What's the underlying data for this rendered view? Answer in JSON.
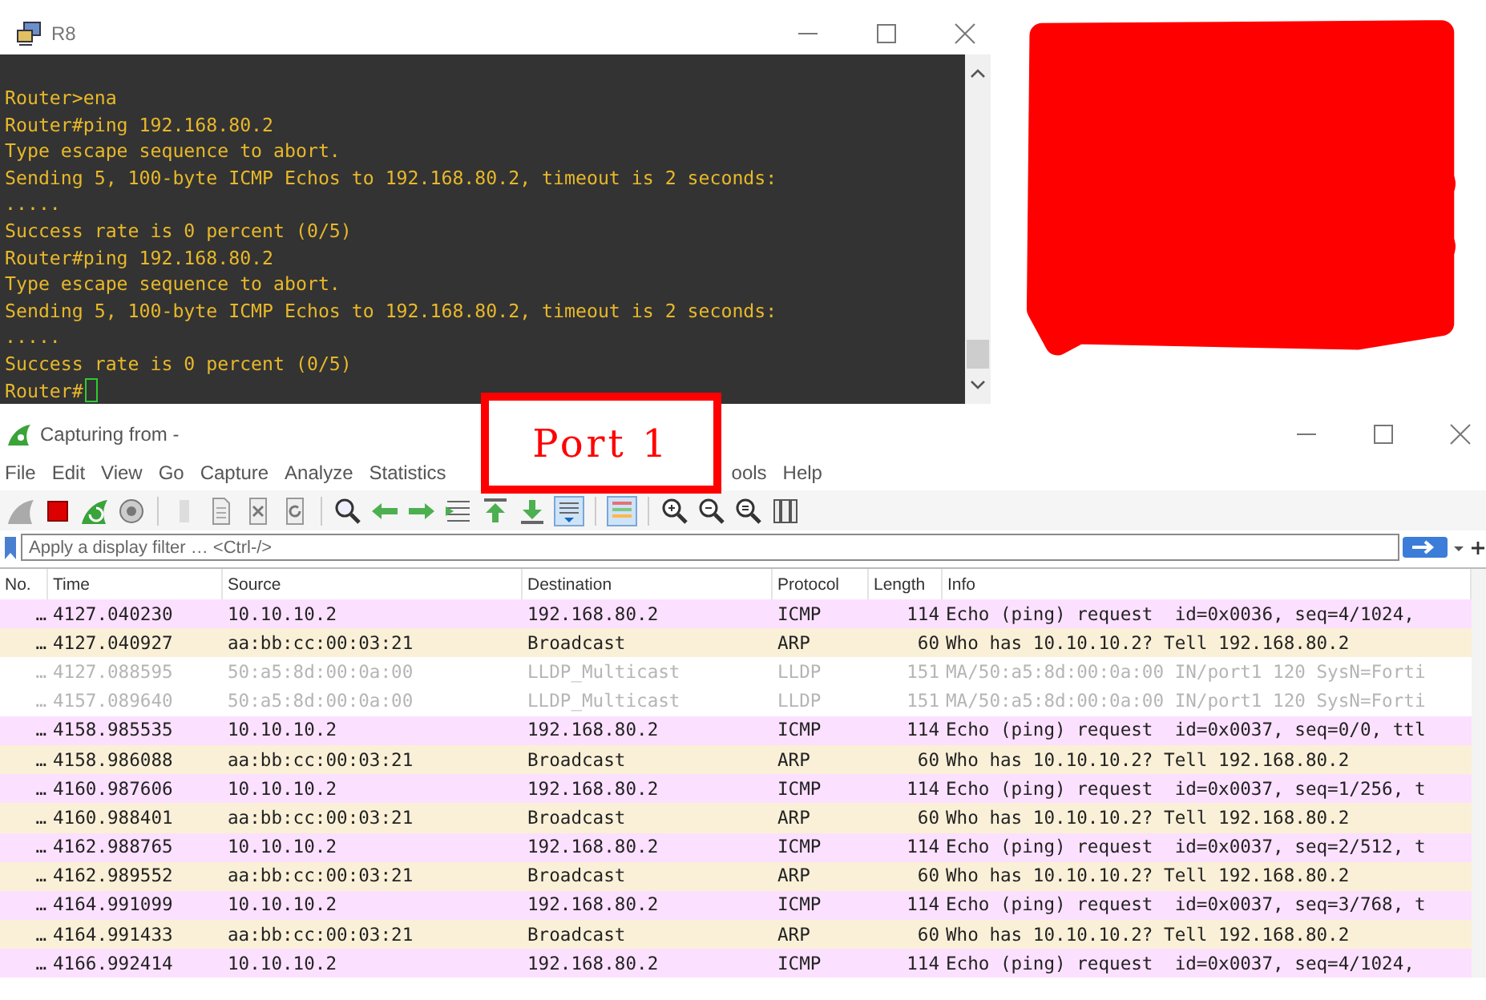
{
  "terminal": {
    "title": "R8",
    "cursor": true,
    "lines": [
      "Router>ena",
      "Router#ping 192.168.80.2",
      "Type escape sequence to abort.",
      "Sending 5, 100-byte ICMP Echos to 192.168.80.2, timeout is 2 seconds:",
      ".....",
      "Success rate is 0 percent (0/5)",
      "Router#ping 192.168.80.2",
      "Type escape sequence to abort.",
      "Sending 5, 100-byte ICMP Echos to 192.168.80.2, timeout is 2 seconds:",
      ".....",
      "Success rate is 0 percent (0/5)",
      "Router#"
    ]
  },
  "annotation": {
    "label": "Port 1"
  },
  "wireshark": {
    "title": "Capturing from -",
    "menu": [
      "File",
      "Edit",
      "View",
      "Go",
      "Capture",
      "Analyze",
      "Statistics",
      "ools",
      "Help"
    ],
    "filter": {
      "placeholder": "Apply a display filter … <Ctrl-/>"
    },
    "table": {
      "columns": [
        "No.",
        "Time",
        "Source",
        "Destination",
        "Protocol",
        "Length",
        "Info"
      ],
      "rows": [
        {
          "kind": "icmp",
          "cells": [
            "…",
            "4127.040230",
            "10.10.10.2",
            "192.168.80.2",
            "ICMP",
            "114",
            "Echo (ping) request  id=0x0036, seq=4/1024,"
          ]
        },
        {
          "kind": "arp",
          "cells": [
            "…",
            "4127.040927",
            "aa:bb:cc:00:03:21",
            "Broadcast",
            "ARP",
            "60",
            "Who has 10.10.10.2? Tell 192.168.80.2"
          ]
        },
        {
          "kind": "lldp",
          "cells": [
            "…",
            "4127.088595",
            "50:a5:8d:00:0a:00",
            "LLDP_Multicast",
            "LLDP",
            "151",
            "MA/50:a5:8d:00:0a:00 IN/port1 120 SysN=Forti"
          ]
        },
        {
          "kind": "lldp",
          "cells": [
            "…",
            "4157.089640",
            "50:a5:8d:00:0a:00",
            "LLDP_Multicast",
            "LLDP",
            "151",
            "MA/50:a5:8d:00:0a:00 IN/port1 120 SysN=Forti"
          ]
        },
        {
          "kind": "icmp",
          "cells": [
            "…",
            "4158.985535",
            "10.10.10.2",
            "192.168.80.2",
            "ICMP",
            "114",
            "Echo (ping) request  id=0x0037, seq=0/0, ttl"
          ]
        },
        {
          "kind": "arp",
          "cells": [
            "…",
            "4158.986088",
            "aa:bb:cc:00:03:21",
            "Broadcast",
            "ARP",
            "60",
            "Who has 10.10.10.2? Tell 192.168.80.2"
          ]
        },
        {
          "kind": "icmp",
          "cells": [
            "…",
            "4160.987606",
            "10.10.10.2",
            "192.168.80.2",
            "ICMP",
            "114",
            "Echo (ping) request  id=0x0037, seq=1/256, t"
          ]
        },
        {
          "kind": "arp",
          "cells": [
            "…",
            "4160.988401",
            "aa:bb:cc:00:03:21",
            "Broadcast",
            "ARP",
            "60",
            "Who has 10.10.10.2? Tell 192.168.80.2"
          ]
        },
        {
          "kind": "icmp",
          "cells": [
            "…",
            "4162.988765",
            "10.10.10.2",
            "192.168.80.2",
            "ICMP",
            "114",
            "Echo (ping) request  id=0x0037, seq=2/512, t"
          ]
        },
        {
          "kind": "arp",
          "cells": [
            "…",
            "4162.989552",
            "aa:bb:cc:00:03:21",
            "Broadcast",
            "ARP",
            "60",
            "Who has 10.10.10.2? Tell 192.168.80.2"
          ]
        },
        {
          "kind": "icmp",
          "cells": [
            "…",
            "4164.991099",
            "10.10.10.2",
            "192.168.80.2",
            "ICMP",
            "114",
            "Echo (ping) request  id=0x0037, seq=3/768, t"
          ]
        },
        {
          "kind": "arp",
          "cells": [
            "…",
            "4164.991433",
            "aa:bb:cc:00:03:21",
            "Broadcast",
            "ARP",
            "60",
            "Who has 10.10.10.2? Tell 192.168.80.2"
          ]
        },
        {
          "kind": "icmp",
          "cells": [
            "…",
            "4166.992414",
            "10.10.10.2",
            "192.168.80.2",
            "ICMP",
            "114",
            "Echo (ping) request  id=0x0037, seq=4/1024,"
          ]
        }
      ]
    }
  }
}
